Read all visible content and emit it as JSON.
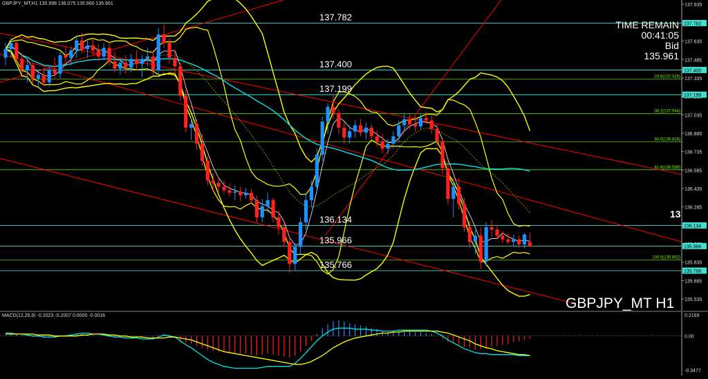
{
  "header": {
    "info": "GBPJPY_MT,H1  135.998 136.075 135.960 135.961"
  },
  "timer": {
    "label": "TIME REMAIN",
    "value": "00:41:05",
    "bid_label": "Bid",
    "bid": "135.961"
  },
  "symbol_label": "GBPJPY_MT H1",
  "side_big_label": "13",
  "macd_header": "MACD(12,26,9) -0.2023 -0.2007 0.0000 -0.0016",
  "colors": {
    "background": "#000000",
    "bull": "#1e90ff",
    "bear": "#ff2020",
    "bands": "#ffff00",
    "ma_cyan": "#00e5ee",
    "ma_white": "#e0e0e0",
    "channel": "#ff0000",
    "level_line": "#40e0d0",
    "fib": "#7cfc00",
    "macd_signal": "#ffff00",
    "macd_line": "#00e5ee"
  },
  "chart_data": [
    {
      "type": "candlestick",
      "title": "GBPJPY_MT H1",
      "ylim": [
        135.44,
        137.97
      ],
      "y_ticks": [
        "137.935",
        "137.785",
        "137.635",
        "137.485",
        "137.335",
        "137.185",
        "137.035",
        "136.885",
        "136.735",
        "136.585",
        "136.435",
        "136.285",
        "136.135",
        "135.985",
        "135.835",
        "135.685",
        "135.535"
      ],
      "candles": [
        {
          "o": 137.5,
          "h": 137.62,
          "l": 137.44,
          "c": 137.57
        },
        {
          "o": 137.57,
          "h": 137.66,
          "l": 137.5,
          "c": 137.62
        },
        {
          "o": 137.62,
          "h": 137.65,
          "l": 137.45,
          "c": 137.49
        },
        {
          "o": 137.49,
          "h": 137.54,
          "l": 137.37,
          "c": 137.4
        },
        {
          "o": 137.4,
          "h": 137.48,
          "l": 137.3,
          "c": 137.44
        },
        {
          "o": 137.44,
          "h": 137.46,
          "l": 137.29,
          "c": 137.33
        },
        {
          "o": 137.33,
          "h": 137.4,
          "l": 137.25,
          "c": 137.36
        },
        {
          "o": 137.36,
          "h": 137.42,
          "l": 137.27,
          "c": 137.3
        },
        {
          "o": 137.3,
          "h": 137.44,
          "l": 137.26,
          "c": 137.4
        },
        {
          "o": 137.4,
          "h": 137.5,
          "l": 137.33,
          "c": 137.37
        },
        {
          "o": 137.37,
          "h": 137.55,
          "l": 137.33,
          "c": 137.52
        },
        {
          "o": 137.52,
          "h": 137.6,
          "l": 137.46,
          "c": 137.5
        },
        {
          "o": 137.5,
          "h": 137.59,
          "l": 137.44,
          "c": 137.56
        },
        {
          "o": 137.56,
          "h": 137.68,
          "l": 137.5,
          "c": 137.64
        },
        {
          "o": 137.64,
          "h": 137.7,
          "l": 137.54,
          "c": 137.57
        },
        {
          "o": 137.57,
          "h": 137.64,
          "l": 137.5,
          "c": 137.6
        },
        {
          "o": 137.6,
          "h": 137.66,
          "l": 137.52,
          "c": 137.56
        },
        {
          "o": 137.56,
          "h": 137.61,
          "l": 137.47,
          "c": 137.51
        },
        {
          "o": 137.51,
          "h": 137.62,
          "l": 137.48,
          "c": 137.58
        },
        {
          "o": 137.58,
          "h": 137.63,
          "l": 137.44,
          "c": 137.47
        },
        {
          "o": 137.47,
          "h": 137.55,
          "l": 137.38,
          "c": 137.41
        },
        {
          "o": 137.41,
          "h": 137.5,
          "l": 137.36,
          "c": 137.46
        },
        {
          "o": 137.46,
          "h": 137.52,
          "l": 137.37,
          "c": 137.42
        },
        {
          "o": 137.42,
          "h": 137.53,
          "l": 137.38,
          "c": 137.49
        },
        {
          "o": 137.49,
          "h": 137.56,
          "l": 137.4,
          "c": 137.45
        },
        {
          "o": 137.45,
          "h": 137.52,
          "l": 137.34,
          "c": 137.49
        },
        {
          "o": 137.49,
          "h": 137.58,
          "l": 137.43,
          "c": 137.51
        },
        {
          "o": 137.51,
          "h": 137.55,
          "l": 137.36,
          "c": 137.4
        },
        {
          "o": 137.4,
          "h": 137.74,
          "l": 137.36,
          "c": 137.69
        },
        {
          "o": 137.69,
          "h": 137.77,
          "l": 137.58,
          "c": 137.62
        },
        {
          "o": 137.62,
          "h": 137.66,
          "l": 137.45,
          "c": 137.5
        },
        {
          "o": 137.5,
          "h": 137.56,
          "l": 137.37,
          "c": 137.43
        },
        {
          "o": 137.43,
          "h": 137.46,
          "l": 137.15,
          "c": 137.19
        },
        {
          "o": 137.19,
          "h": 137.24,
          "l": 136.89,
          "c": 136.93
        },
        {
          "o": 136.93,
          "h": 137.01,
          "l": 136.83,
          "c": 136.96
        },
        {
          "o": 136.96,
          "h": 137.0,
          "l": 136.75,
          "c": 136.8
        },
        {
          "o": 136.8,
          "h": 136.88,
          "l": 136.62,
          "c": 136.66
        },
        {
          "o": 136.66,
          "h": 136.7,
          "l": 136.46,
          "c": 136.5
        },
        {
          "o": 136.5,
          "h": 136.56,
          "l": 136.41,
          "c": 136.48
        },
        {
          "o": 136.48,
          "h": 136.53,
          "l": 136.41,
          "c": 136.45
        },
        {
          "o": 136.45,
          "h": 136.5,
          "l": 136.39,
          "c": 136.42
        },
        {
          "o": 136.42,
          "h": 136.47,
          "l": 136.37,
          "c": 136.4
        },
        {
          "o": 136.4,
          "h": 136.46,
          "l": 136.34,
          "c": 136.41
        },
        {
          "o": 136.41,
          "h": 136.45,
          "l": 136.33,
          "c": 136.38
        },
        {
          "o": 136.38,
          "h": 136.44,
          "l": 136.35,
          "c": 136.4
        },
        {
          "o": 136.4,
          "h": 136.43,
          "l": 136.31,
          "c": 136.34
        },
        {
          "o": 136.34,
          "h": 136.38,
          "l": 136.16,
          "c": 136.2
        },
        {
          "o": 136.2,
          "h": 136.35,
          "l": 136.16,
          "c": 136.29
        },
        {
          "o": 136.29,
          "h": 136.4,
          "l": 136.24,
          "c": 136.34
        },
        {
          "o": 136.34,
          "h": 136.36,
          "l": 136.16,
          "c": 136.2
        },
        {
          "o": 136.2,
          "h": 136.25,
          "l": 136.06,
          "c": 136.12
        },
        {
          "o": 136.12,
          "h": 136.16,
          "l": 135.96,
          "c": 136.0
        },
        {
          "o": 136.0,
          "h": 136.04,
          "l": 135.75,
          "c": 135.82
        },
        {
          "o": 135.82,
          "h": 135.99,
          "l": 135.77,
          "c": 135.96
        },
        {
          "o": 135.96,
          "h": 136.2,
          "l": 135.9,
          "c": 136.16
        },
        {
          "o": 136.16,
          "h": 136.38,
          "l": 136.1,
          "c": 136.34
        },
        {
          "o": 136.34,
          "h": 136.5,
          "l": 136.28,
          "c": 136.45
        },
        {
          "o": 136.45,
          "h": 136.76,
          "l": 136.4,
          "c": 136.71
        },
        {
          "o": 136.71,
          "h": 137.02,
          "l": 136.66,
          "c": 136.98
        },
        {
          "o": 136.98,
          "h": 137.13,
          "l": 136.88,
          "c": 137.1
        },
        {
          "o": 137.1,
          "h": 137.2,
          "l": 137.0,
          "c": 137.05
        },
        {
          "o": 137.05,
          "h": 137.08,
          "l": 136.88,
          "c": 136.93
        },
        {
          "o": 136.93,
          "h": 136.98,
          "l": 136.8,
          "c": 136.85
        },
        {
          "o": 136.85,
          "h": 136.95,
          "l": 136.8,
          "c": 136.9
        },
        {
          "o": 136.9,
          "h": 136.99,
          "l": 136.85,
          "c": 136.95
        },
        {
          "o": 136.95,
          "h": 137.0,
          "l": 136.86,
          "c": 136.89
        },
        {
          "o": 136.89,
          "h": 136.97,
          "l": 136.84,
          "c": 136.93
        },
        {
          "o": 136.93,
          "h": 136.96,
          "l": 136.83,
          "c": 136.86
        },
        {
          "o": 136.86,
          "h": 136.91,
          "l": 136.78,
          "c": 136.82
        },
        {
          "o": 136.82,
          "h": 136.88,
          "l": 136.72,
          "c": 136.76
        },
        {
          "o": 136.76,
          "h": 136.84,
          "l": 136.72,
          "c": 136.8
        },
        {
          "o": 136.8,
          "h": 136.9,
          "l": 136.76,
          "c": 136.86
        },
        {
          "o": 136.86,
          "h": 136.99,
          "l": 136.81,
          "c": 136.95
        },
        {
          "o": 136.95,
          "h": 137.05,
          "l": 136.9,
          "c": 137.0
        },
        {
          "o": 137.0,
          "h": 137.04,
          "l": 136.92,
          "c": 136.96
        },
        {
          "o": 136.96,
          "h": 137.02,
          "l": 136.9,
          "c": 136.94
        },
        {
          "o": 136.94,
          "h": 137.05,
          "l": 136.91,
          "c": 137.01
        },
        {
          "o": 137.01,
          "h": 137.06,
          "l": 136.96,
          "c": 136.99
        },
        {
          "o": 136.99,
          "h": 137.03,
          "l": 136.88,
          "c": 136.92
        },
        {
          "o": 136.92,
          "h": 136.96,
          "l": 136.78,
          "c": 136.82
        },
        {
          "o": 136.82,
          "h": 136.85,
          "l": 136.55,
          "c": 136.6
        },
        {
          "o": 136.6,
          "h": 136.66,
          "l": 136.3,
          "c": 136.35
        },
        {
          "o": 136.35,
          "h": 136.5,
          "l": 136.2,
          "c": 136.45
        },
        {
          "o": 136.45,
          "h": 136.52,
          "l": 136.26,
          "c": 136.31
        },
        {
          "o": 136.31,
          "h": 136.36,
          "l": 136.08,
          "c": 136.12
        },
        {
          "o": 136.12,
          "h": 136.17,
          "l": 135.95,
          "c": 136.0
        },
        {
          "o": 136.0,
          "h": 136.1,
          "l": 135.9,
          "c": 136.05
        },
        {
          "o": 136.05,
          "h": 136.12,
          "l": 135.78,
          "c": 135.84
        },
        {
          "o": 135.84,
          "h": 136.16,
          "l": 135.8,
          "c": 136.12
        },
        {
          "o": 136.12,
          "h": 136.18,
          "l": 136.04,
          "c": 136.1
        },
        {
          "o": 136.1,
          "h": 136.14,
          "l": 136.02,
          "c": 136.05
        },
        {
          "o": 136.05,
          "h": 136.09,
          "l": 135.99,
          "c": 136.02
        },
        {
          "o": 136.02,
          "h": 136.07,
          "l": 135.98,
          "c": 136.0
        },
        {
          "o": 136.0,
          "h": 136.06,
          "l": 135.96,
          "c": 136.02
        },
        {
          "o": 136.02,
          "h": 136.05,
          "l": 135.95,
          "c": 135.98
        },
        {
          "o": 135.98,
          "h": 136.07,
          "l": 135.95,
          "c": 136.06
        },
        {
          "o": 135.998,
          "h": 136.075,
          "l": 135.96,
          "c": 135.961
        }
      ],
      "level_lines": [
        {
          "value": 137.782,
          "label": "137.782",
          "tag": "137.782"
        },
        {
          "value": 137.4,
          "label": "137.400",
          "tag": "137.400"
        },
        {
          "value": 137.199,
          "label": "137.199",
          "tag": "137.199"
        },
        {
          "value": 136.134,
          "label": "136.134",
          "tag": "136.134"
        },
        {
          "value": 135.966,
          "label": "135.966",
          "tag": "135.966"
        },
        {
          "value": 135.766,
          "label": "135.766",
          "tag": "135.766"
        }
      ],
      "fib_levels": [
        {
          "value": 137.325,
          "label": "23.6(137.325)"
        },
        {
          "value": 137.044,
          "label": "38.2(137.044)"
        },
        {
          "value": 136.816,
          "label": "50.0(136.816)"
        },
        {
          "value": 136.588,
          "label": "61.8(136.588)"
        },
        {
          "value": 135.852,
          "label": "100.0(135.852)"
        }
      ]
    },
    {
      "type": "bar",
      "title": "MACD(12,26,9)",
      "ylim": [
        -0.3477,
        0.2169
      ],
      "y_ticks": [
        "0.2169",
        "0.00",
        "-0.3477"
      ],
      "histogram": [
        0.01,
        0.02,
        0.02,
        0.01,
        0.0,
        -0.01,
        -0.01,
        -0.02,
        -0.02,
        -0.01,
        0.0,
        0.01,
        0.01,
        0.02,
        0.02,
        0.01,
        0.01,
        0.0,
        0.0,
        -0.01,
        -0.02,
        -0.01,
        -0.02,
        -0.01,
        -0.01,
        -0.02,
        -0.01,
        -0.02,
        0.01,
        0.02,
        0.01,
        -0.01,
        -0.04,
        -0.07,
        -0.08,
        -0.1,
        -0.12,
        -0.14,
        -0.15,
        -0.16,
        -0.16,
        -0.17,
        -0.17,
        -0.18,
        -0.18,
        -0.19,
        -0.2,
        -0.19,
        -0.18,
        -0.19,
        -0.2,
        -0.21,
        -0.22,
        -0.2,
        -0.16,
        -0.1,
        -0.05,
        0.02,
        0.08,
        0.12,
        0.15,
        0.16,
        0.15,
        0.13,
        0.12,
        0.11,
        0.1,
        0.08,
        0.07,
        0.05,
        0.04,
        0.04,
        0.05,
        0.05,
        0.05,
        0.04,
        0.04,
        0.03,
        0.02,
        0.0,
        -0.03,
        -0.06,
        -0.07,
        -0.09,
        -0.11,
        -0.12,
        -0.14,
        -0.13,
        -0.12,
        -0.11,
        -0.1,
        -0.09,
        -0.08,
        -0.06,
        -0.05,
        -0.04,
        -0.03
      ],
      "macd": [
        0.03,
        0.03,
        0.02,
        0.02,
        0.01,
        0.0,
        0.0,
        -0.01,
        -0.01,
        -0.01,
        0.0,
        0.0,
        0.01,
        0.02,
        0.03,
        0.03,
        0.02,
        0.02,
        0.01,
        0.0,
        -0.01,
        -0.01,
        -0.02,
        -0.02,
        -0.02,
        -0.03,
        -0.03,
        -0.03,
        -0.01,
        0.01,
        0.0,
        -0.01,
        -0.05,
        -0.09,
        -0.12,
        -0.16,
        -0.2,
        -0.24,
        -0.27,
        -0.29,
        -0.31,
        -0.32,
        -0.33,
        -0.33,
        -0.33,
        -0.33,
        -0.33,
        -0.32,
        -0.31,
        -0.31,
        -0.31,
        -0.31,
        -0.31,
        -0.28,
        -0.23,
        -0.17,
        -0.11,
        -0.05,
        0.0,
        0.04,
        0.07,
        0.08,
        0.08,
        0.08,
        0.07,
        0.07,
        0.07,
        0.06,
        0.06,
        0.05,
        0.05,
        0.05,
        0.06,
        0.06,
        0.06,
        0.06,
        0.06,
        0.06,
        0.05,
        0.03,
        0.0,
        -0.04,
        -0.07,
        -0.1,
        -0.13,
        -0.15,
        -0.17,
        -0.18,
        -0.18,
        -0.19,
        -0.19,
        -0.19,
        -0.19,
        -0.19,
        -0.2,
        -0.2,
        -0.2
      ],
      "signal": [
        0.02,
        0.02,
        0.02,
        0.02,
        0.02,
        0.02,
        0.01,
        0.01,
        0.01,
        0.0,
        0.0,
        0.0,
        0.0,
        0.0,
        0.01,
        0.01,
        0.02,
        0.02,
        0.02,
        0.01,
        0.01,
        0.0,
        0.0,
        -0.01,
        -0.01,
        -0.01,
        -0.02,
        -0.02,
        -0.02,
        -0.02,
        -0.01,
        -0.01,
        -0.02,
        -0.03,
        -0.04,
        -0.06,
        -0.08,
        -0.1,
        -0.12,
        -0.14,
        -0.16,
        -0.17,
        -0.18,
        -0.19,
        -0.2,
        -0.21,
        -0.22,
        -0.23,
        -0.24,
        -0.25,
        -0.26,
        -0.27,
        -0.28,
        -0.29,
        -0.29,
        -0.28,
        -0.26,
        -0.23,
        -0.2,
        -0.16,
        -0.12,
        -0.09,
        -0.06,
        -0.04,
        -0.02,
        -0.01,
        0.0,
        0.01,
        0.02,
        0.03,
        0.03,
        0.04,
        0.04,
        0.05,
        0.05,
        0.05,
        0.05,
        0.05,
        0.05,
        0.05,
        0.04,
        0.03,
        0.01,
        -0.01,
        -0.03,
        -0.05,
        -0.08,
        -0.1,
        -0.12,
        -0.13,
        -0.15,
        -0.16,
        -0.17,
        -0.18,
        -0.19,
        -0.19,
        -0.2
      ]
    }
  ]
}
